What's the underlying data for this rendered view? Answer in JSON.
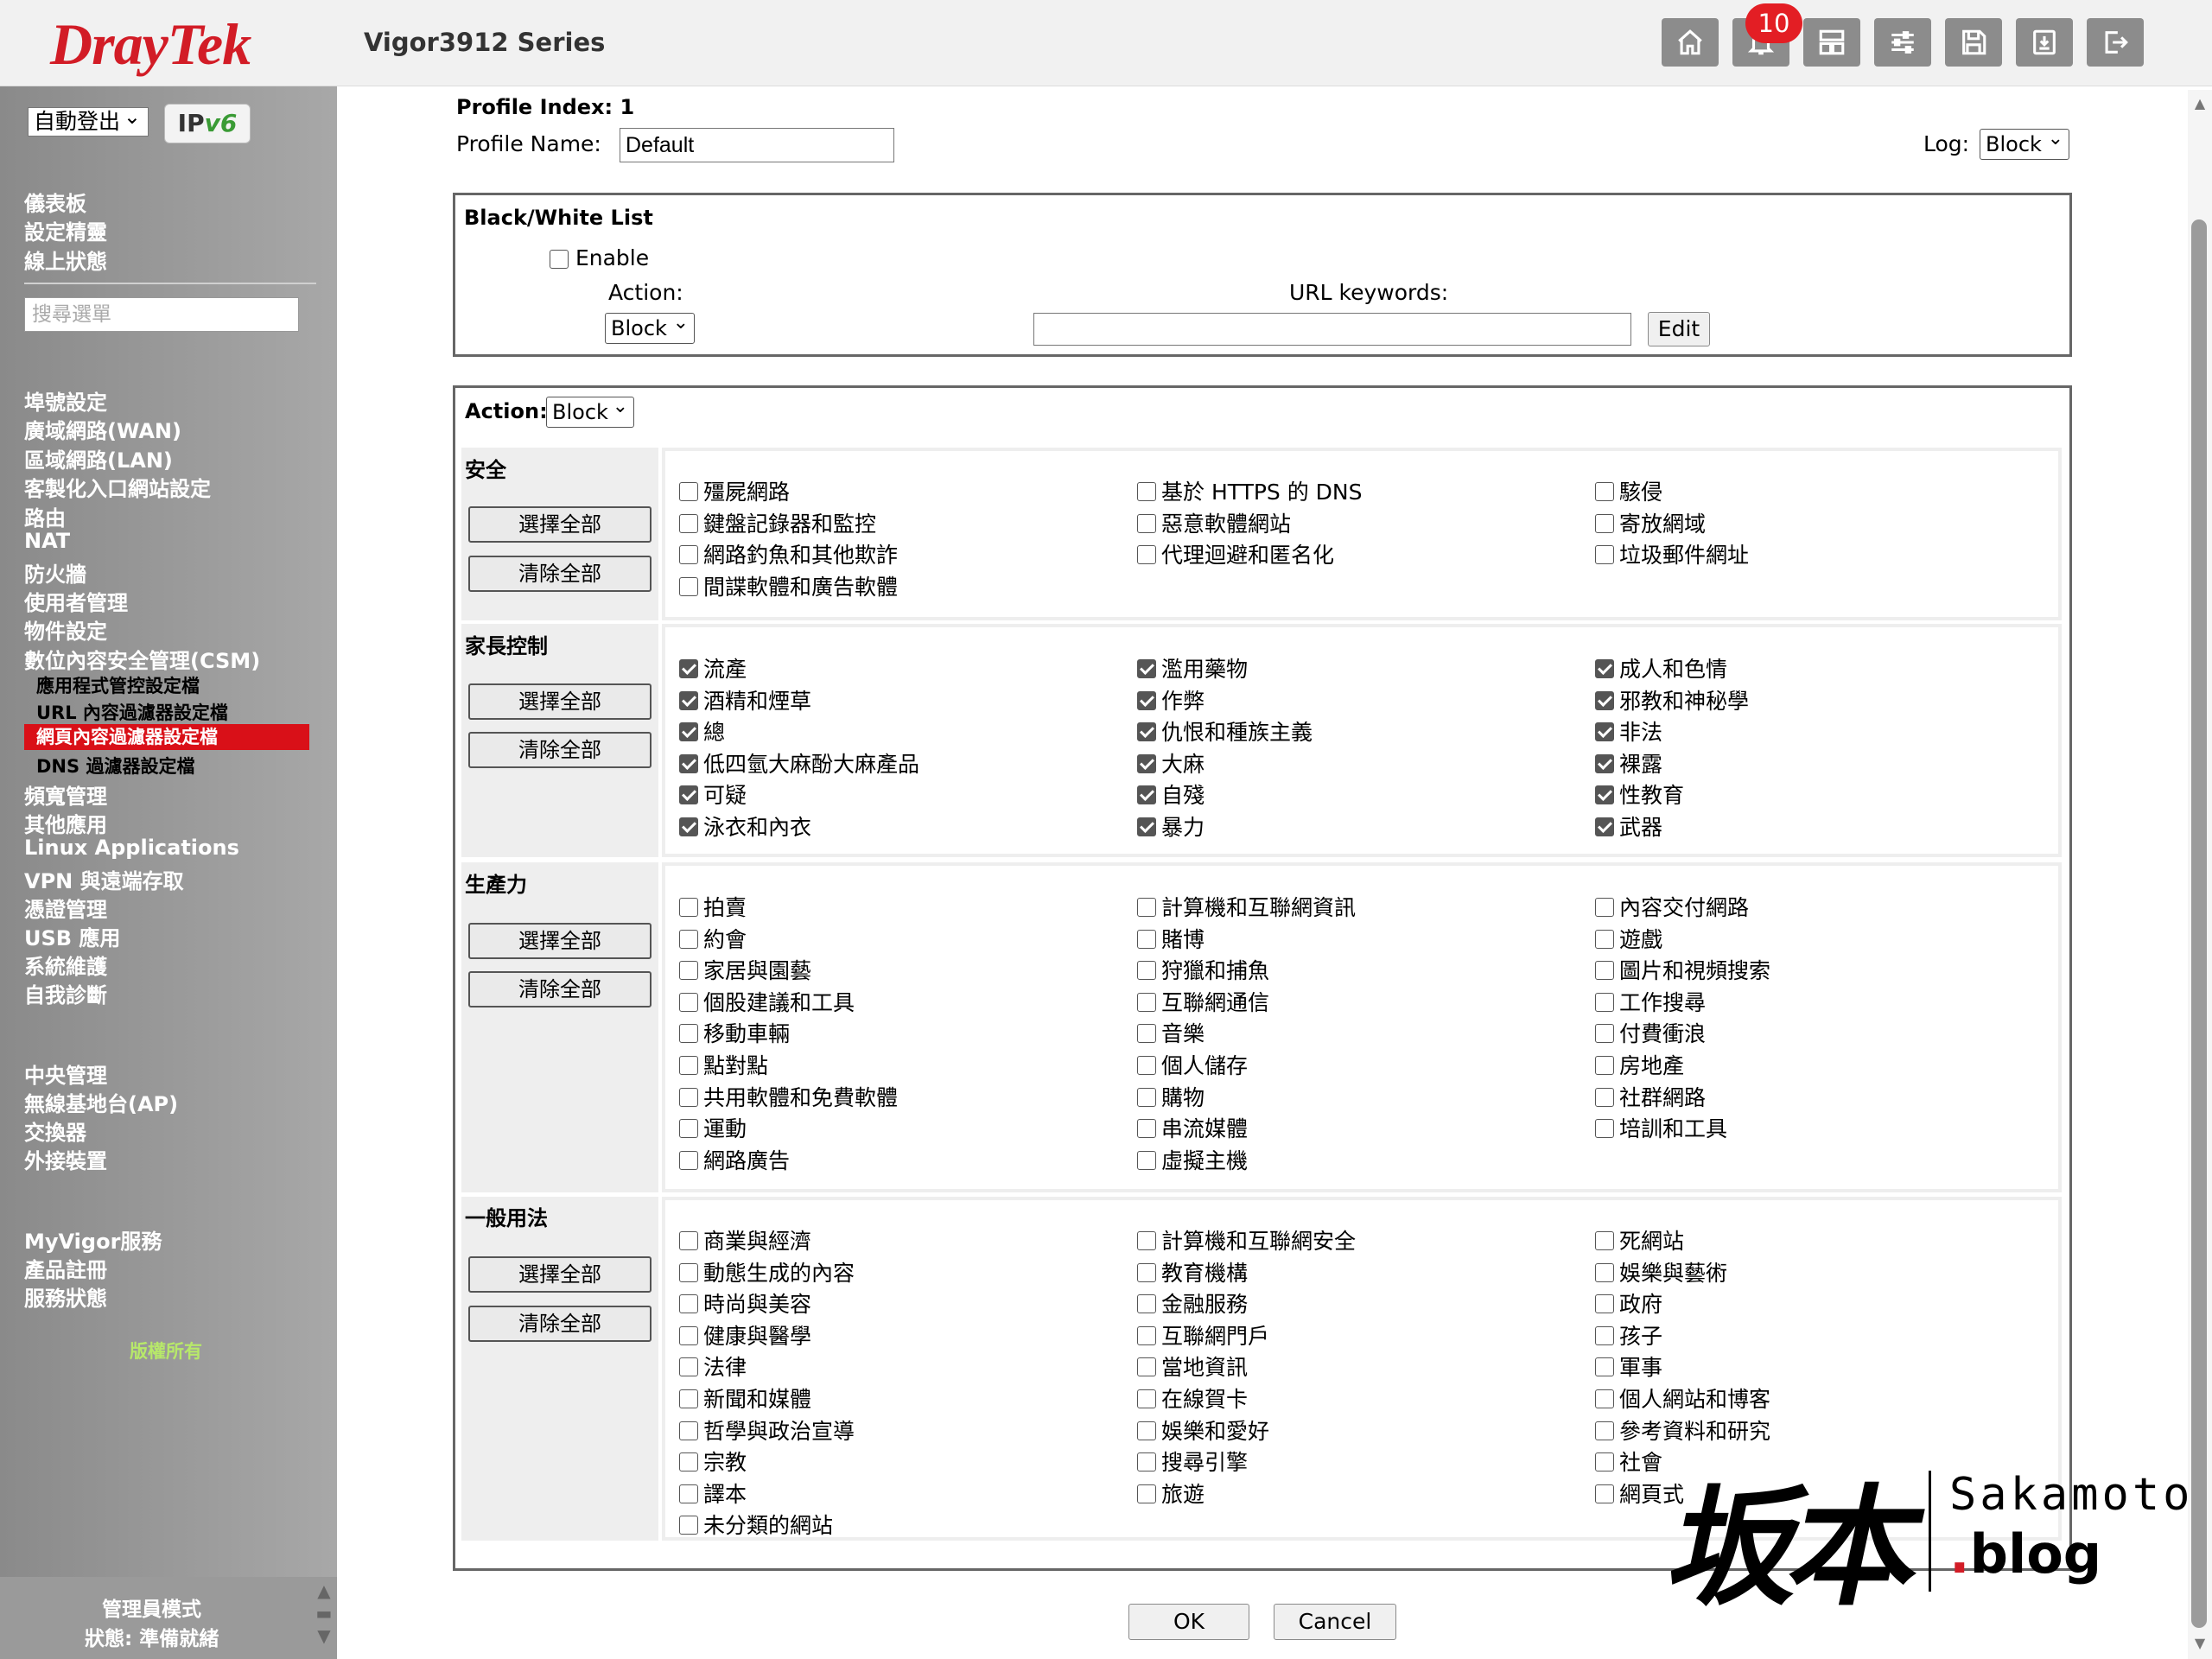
{
  "header": {
    "logo": "DrayTek",
    "model": "Vigor3912 Series",
    "notification_count": "10",
    "icons": [
      "home-icon",
      "bell-icon",
      "layout-icon",
      "sliders-icon",
      "save-icon",
      "export-icon",
      "logout-icon"
    ]
  },
  "sidebar": {
    "autologout": "自動登出",
    "ipv6_badge": {
      "ip": "IP",
      "v": "v6"
    },
    "search_placeholder": "搜尋選單",
    "group1": [
      "儀表板",
      "設定精靈",
      "線上狀態"
    ],
    "group2": [
      "埠號設定",
      "廣域網路(WAN)",
      "區域網路(LAN)",
      "客製化入口網站設定",
      "路由",
      "NAT",
      "防火牆",
      "使用者管理",
      "物件設定",
      "數位內容安全管理(CSM)"
    ],
    "csm_sub": [
      "應用程式管控設定檔",
      "URL 內容過濾器設定檔",
      "網頁內容過濾器設定檔",
      "DNS 過濾器設定檔"
    ],
    "group3": [
      "頻寬管理",
      "其他應用",
      "Linux Applications",
      "VPN 與遠端存取",
      "憑證管理",
      "USB 應用",
      "系統維護",
      "自我診斷"
    ],
    "group4": [
      "中央管理",
      "無線基地台(AP)",
      "交換器",
      "外接裝置"
    ],
    "group5": [
      "MyVigor服務",
      "產品註冊",
      "服務狀態"
    ],
    "copyright": "版權所有",
    "admin_mode": "管理員模式",
    "status": "狀態: 準備就緒"
  },
  "profile": {
    "index_label": "Profile Index: 1",
    "name_label": "Profile Name:",
    "name_value": "Default",
    "log_label": "Log:",
    "log_value": "Block"
  },
  "bwlist": {
    "title": "Black/White List",
    "enable_label": "Enable",
    "action_label": "Action:",
    "action_value": "Block",
    "url_label": "URL keywords:",
    "edit_label": "Edit"
  },
  "categories": {
    "action_label": "Action:",
    "action_value": "Block",
    "select_all": "選擇全部",
    "clear_all": "清除全部",
    "sections": [
      {
        "title": "安全",
        "columns": [
          [
            {
              "l": "殭屍網路",
              "c": false
            },
            {
              "l": "鍵盤記錄器和監控",
              "c": false
            },
            {
              "l": "網路釣魚和其他欺詐",
              "c": false
            },
            {
              "l": "間諜軟體和廣告軟體",
              "c": false
            }
          ],
          [
            {
              "l": "基於 HTTPS 的 DNS",
              "c": false
            },
            {
              "l": "惡意軟體網站",
              "c": false
            },
            {
              "l": "代理迴避和匿名化",
              "c": false
            }
          ],
          [
            {
              "l": "駭侵",
              "c": false
            },
            {
              "l": "寄放網域",
              "c": false
            },
            {
              "l": "垃圾郵件網址",
              "c": false
            }
          ]
        ]
      },
      {
        "title": "家長控制",
        "columns": [
          [
            {
              "l": "流產",
              "c": true
            },
            {
              "l": "酒精和煙草",
              "c": true
            },
            {
              "l": "總",
              "c": true
            },
            {
              "l": "低四氫大麻酚大麻產品",
              "c": true
            },
            {
              "l": "可疑",
              "c": true
            },
            {
              "l": "泳衣和內衣",
              "c": true
            }
          ],
          [
            {
              "l": "濫用藥物",
              "c": true
            },
            {
              "l": "作弊",
              "c": true
            },
            {
              "l": "仇恨和種族主義",
              "c": true
            },
            {
              "l": "大麻",
              "c": true
            },
            {
              "l": "自殘",
              "c": true
            },
            {
              "l": "暴力",
              "c": true
            }
          ],
          [
            {
              "l": "成人和色情",
              "c": true
            },
            {
              "l": "邪教和神秘學",
              "c": true
            },
            {
              "l": "非法",
              "c": true
            },
            {
              "l": "裸露",
              "c": true
            },
            {
              "l": "性教育",
              "c": true
            },
            {
              "l": "武器",
              "c": true
            }
          ]
        ]
      },
      {
        "title": "生產力",
        "columns": [
          [
            {
              "l": "拍賣",
              "c": false
            },
            {
              "l": "約會",
              "c": false
            },
            {
              "l": "家居與園藝",
              "c": false
            },
            {
              "l": "個股建議和工具",
              "c": false
            },
            {
              "l": "移動車輛",
              "c": false
            },
            {
              "l": "點對點",
              "c": false
            },
            {
              "l": "共用軟體和免費軟體",
              "c": false
            },
            {
              "l": "運動",
              "c": false
            },
            {
              "l": "網路廣告",
              "c": false
            }
          ],
          [
            {
              "l": "計算機和互聯網資訊",
              "c": false
            },
            {
              "l": "賭博",
              "c": false
            },
            {
              "l": "狩獵和捕魚",
              "c": false
            },
            {
              "l": "互聯網通信",
              "c": false
            },
            {
              "l": "音樂",
              "c": false
            },
            {
              "l": "個人儲存",
              "c": false
            },
            {
              "l": "購物",
              "c": false
            },
            {
              "l": "串流媒體",
              "c": false
            },
            {
              "l": "虛擬主機",
              "c": false
            }
          ],
          [
            {
              "l": "內容交付網路",
              "c": false
            },
            {
              "l": "遊戲",
              "c": false
            },
            {
              "l": "圖片和視頻搜索",
              "c": false
            },
            {
              "l": "工作搜尋",
              "c": false
            },
            {
              "l": "付費衝浪",
              "c": false
            },
            {
              "l": "房地產",
              "c": false
            },
            {
              "l": "社群網路",
              "c": false
            },
            {
              "l": "培訓和工具",
              "c": false
            }
          ]
        ]
      },
      {
        "title": "一般用法",
        "columns": [
          [
            {
              "l": "商業與經濟",
              "c": false
            },
            {
              "l": "動態生成的內容",
              "c": false
            },
            {
              "l": "時尚與美容",
              "c": false
            },
            {
              "l": "健康與醫學",
              "c": false
            },
            {
              "l": "法律",
              "c": false
            },
            {
              "l": "新聞和媒體",
              "c": false
            },
            {
              "l": "哲學與政治宣導",
              "c": false
            },
            {
              "l": "宗教",
              "c": false
            },
            {
              "l": "譯本",
              "c": false
            },
            {
              "l": "未分類的網站",
              "c": false
            }
          ],
          [
            {
              "l": "計算機和互聯網安全",
              "c": false
            },
            {
              "l": "教育機構",
              "c": false
            },
            {
              "l": "金融服務",
              "c": false
            },
            {
              "l": "互聯網門戶",
              "c": false
            },
            {
              "l": "當地資訊",
              "c": false
            },
            {
              "l": "在線賀卡",
              "c": false
            },
            {
              "l": "娛樂和愛好",
              "c": false
            },
            {
              "l": "搜尋引擎",
              "c": false
            },
            {
              "l": "旅遊",
              "c": false
            }
          ],
          [
            {
              "l": "死網站",
              "c": false
            },
            {
              "l": "娛樂與藝術",
              "c": false
            },
            {
              "l": "政府",
              "c": false
            },
            {
              "l": "孩子",
              "c": false
            },
            {
              "l": "軍事",
              "c": false
            },
            {
              "l": "個人網站和博客",
              "c": false
            },
            {
              "l": "參考資料和研究",
              "c": false
            },
            {
              "l": "社會",
              "c": false
            },
            {
              "l": "網頁式",
              "c": false
            }
          ]
        ]
      }
    ]
  },
  "buttons": {
    "ok": "OK",
    "cancel": "Cancel"
  },
  "watermark": {
    "cjk": "坂本",
    "latin": "Sakamoto",
    "dot": ".",
    "blog": "blog"
  }
}
